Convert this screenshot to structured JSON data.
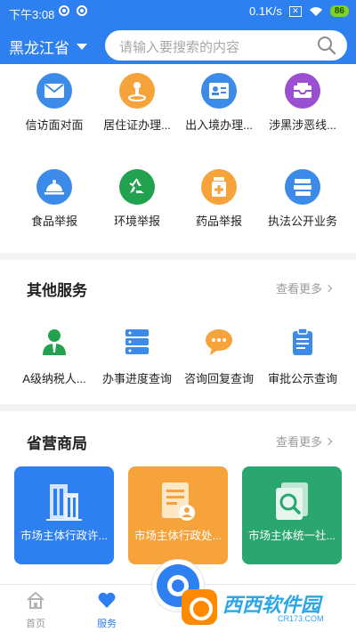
{
  "status_bar": {
    "time": "下午3:08",
    "speed": "0.1K/s",
    "battery": "86"
  },
  "header": {
    "region": "黑龙江省",
    "search_placeholder": "请输入要搜索的内容"
  },
  "top_grid": [
    {
      "label": "信访面对面",
      "icon": "mail-icon",
      "color": "#3d8be8"
    },
    {
      "label": "居住证办理...",
      "icon": "person-pin-icon",
      "color": "#f6a33b"
    },
    {
      "label": "出入境办理...",
      "icon": "id-card-icon",
      "color": "#3d8be8"
    },
    {
      "label": "涉黑涉恶线...",
      "icon": "inbox-icon",
      "color": "#9b4fd1"
    },
    {
      "label": "食品举报",
      "icon": "food-cloche-icon",
      "color": "#3d8be8"
    },
    {
      "label": "环境举报",
      "icon": "recycle-icon",
      "color": "#22a24f"
    },
    {
      "label": "药品举报",
      "icon": "medicine-icon",
      "color": "#f6a33b"
    },
    {
      "label": "执法公开业务",
      "icon": "books-icon",
      "color": "#3d8be8"
    }
  ],
  "other_services": {
    "title": "其他服务",
    "more": "查看更多",
    "items": [
      {
        "label": "A级纳税人...",
        "icon": "taxpayer-person-icon",
        "color": "#22a24f"
      },
      {
        "label": "办事进度查询",
        "icon": "server-list-icon",
        "color": "#3d8be8"
      },
      {
        "label": "咨询回复查询",
        "icon": "chat-bubble-icon",
        "color": "#f6a33b"
      },
      {
        "label": "审批公示查询",
        "icon": "clipboard-icon",
        "color": "#3d8be8"
      }
    ]
  },
  "provincial": {
    "title": "省营商局",
    "more": "查看更多",
    "tiles": [
      {
        "label": "市场主体行政许...",
        "icon": "building-icon",
        "color": "#2e7ff0"
      },
      {
        "label": "市场主体行政处...",
        "icon": "document-user-icon",
        "color": "#f6a33b"
      },
      {
        "label": "市场主体统一社...",
        "icon": "document-search-icon",
        "color": "#2aa66f"
      }
    ]
  },
  "bottom_nav": [
    {
      "label": "首页",
      "icon": "home-icon",
      "active": false
    },
    {
      "label": "服务",
      "icon": "heart-icon",
      "active": true
    }
  ],
  "watermark": {
    "name": "西西软件园",
    "url": "CR173.COM"
  }
}
